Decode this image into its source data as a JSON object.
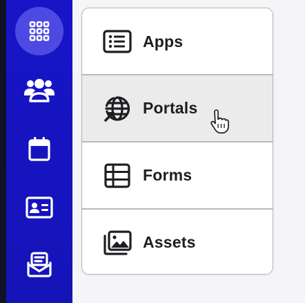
{
  "sidebar": {
    "items": [
      {
        "icon": "app-grid-icon",
        "active": true
      },
      {
        "icon": "users-group-icon",
        "active": false
      },
      {
        "icon": "calendar-icon",
        "active": false
      },
      {
        "icon": "id-card-icon",
        "active": false
      },
      {
        "icon": "mail-inbox-icon",
        "active": false
      }
    ],
    "colors": {
      "background": "#1715c7",
      "active_background": "#4d49e3",
      "icon": "#ffffff"
    }
  },
  "menu": {
    "items": [
      {
        "label": "Apps",
        "icon": "list-icon"
      },
      {
        "label": "Portals",
        "icon": "globe-arrow-icon",
        "hovered": true
      },
      {
        "label": "Forms",
        "icon": "table-icon"
      },
      {
        "label": "Assets",
        "icon": "images-icon"
      }
    ]
  },
  "cursor": {
    "icon": "hand-pointer-icon"
  }
}
